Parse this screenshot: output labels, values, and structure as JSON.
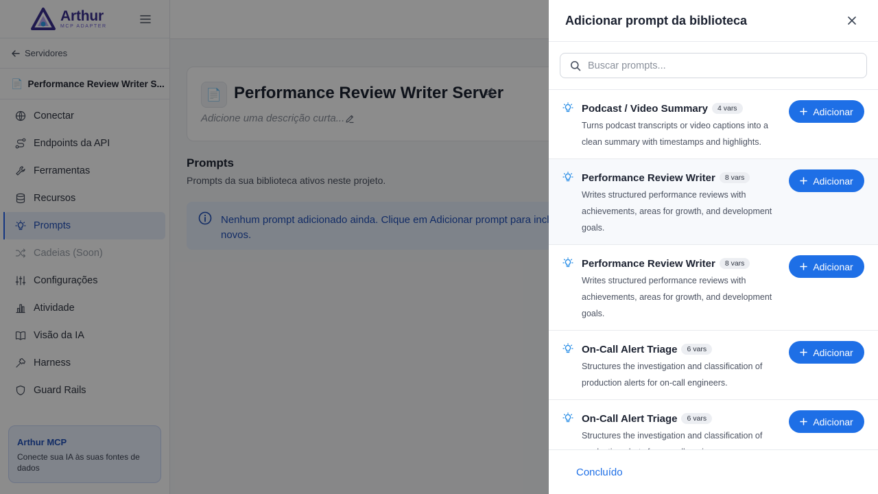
{
  "brand": {
    "name": "Arthur",
    "sub": "MCP ADAPTER"
  },
  "sidebar": {
    "back_label": "Servidores",
    "server_name": "Performance Review Writer S...",
    "items": [
      {
        "label": "Conectar",
        "icon": "globe-icon"
      },
      {
        "label": "Endpoints da API",
        "icon": "route-icon"
      },
      {
        "label": "Ferramentas",
        "icon": "wrench-icon"
      },
      {
        "label": "Recursos",
        "icon": "database-icon"
      },
      {
        "label": "Prompts",
        "icon": "lightbulb-icon",
        "active": true
      },
      {
        "label": "Cadeias (Soon)",
        "icon": "shuffle-icon",
        "disabled": true
      },
      {
        "label": "Configurações",
        "icon": "sliders-icon"
      },
      {
        "label": "Atividade",
        "icon": "bar-chart-icon"
      },
      {
        "label": "Visão da IA",
        "icon": "book-icon"
      },
      {
        "label": "Harness",
        "icon": "hammer-icon"
      },
      {
        "label": "Guard Rails",
        "icon": "shield-icon"
      }
    ],
    "promo": {
      "title": "Arthur MCP",
      "text": "Conecte sua IA às suas fontes de dados"
    }
  },
  "main": {
    "server_title": "Performance Review Writer Server",
    "description_placeholder": "Adicione uma descrição curta...",
    "section_title": "Prompts",
    "section_sub": "Prompts da sua biblioteca ativos neste projeto.",
    "info_text": "Nenhum prompt adicionado ainda. Clique em Adicionar prompt para incluir novos."
  },
  "drawer": {
    "title": "Adicionar prompt da biblioteca",
    "search_placeholder": "Buscar prompts...",
    "add_label": "Adicionar",
    "done_label": "Concluído",
    "items": [
      {
        "title": "Podcast / Video Summary",
        "badge": "4 vars",
        "desc": "Turns podcast transcripts or video captions into a clean summary with timestamps and highlights."
      },
      {
        "title": "Performance Review Writer",
        "badge": "8 vars",
        "desc": "Writes structured performance reviews with achievements, areas for growth, and development goals."
      },
      {
        "title": "Performance Review Writer",
        "badge": "8 vars",
        "desc": "Writes structured performance reviews with achievements, areas for growth, and development goals."
      },
      {
        "title": "On-Call Alert Triage",
        "badge": "6 vars",
        "desc": "Structures the investigation and classification of production alerts for on-call engineers."
      },
      {
        "title": "On-Call Alert Triage",
        "badge": "6 vars",
        "desc": "Structures the investigation and classification of production alerts for on-call engineers."
      }
    ]
  },
  "colors": {
    "accent": "#1e6fe6",
    "brand": "#3a2e8f",
    "info_bg": "#e6eefc"
  }
}
